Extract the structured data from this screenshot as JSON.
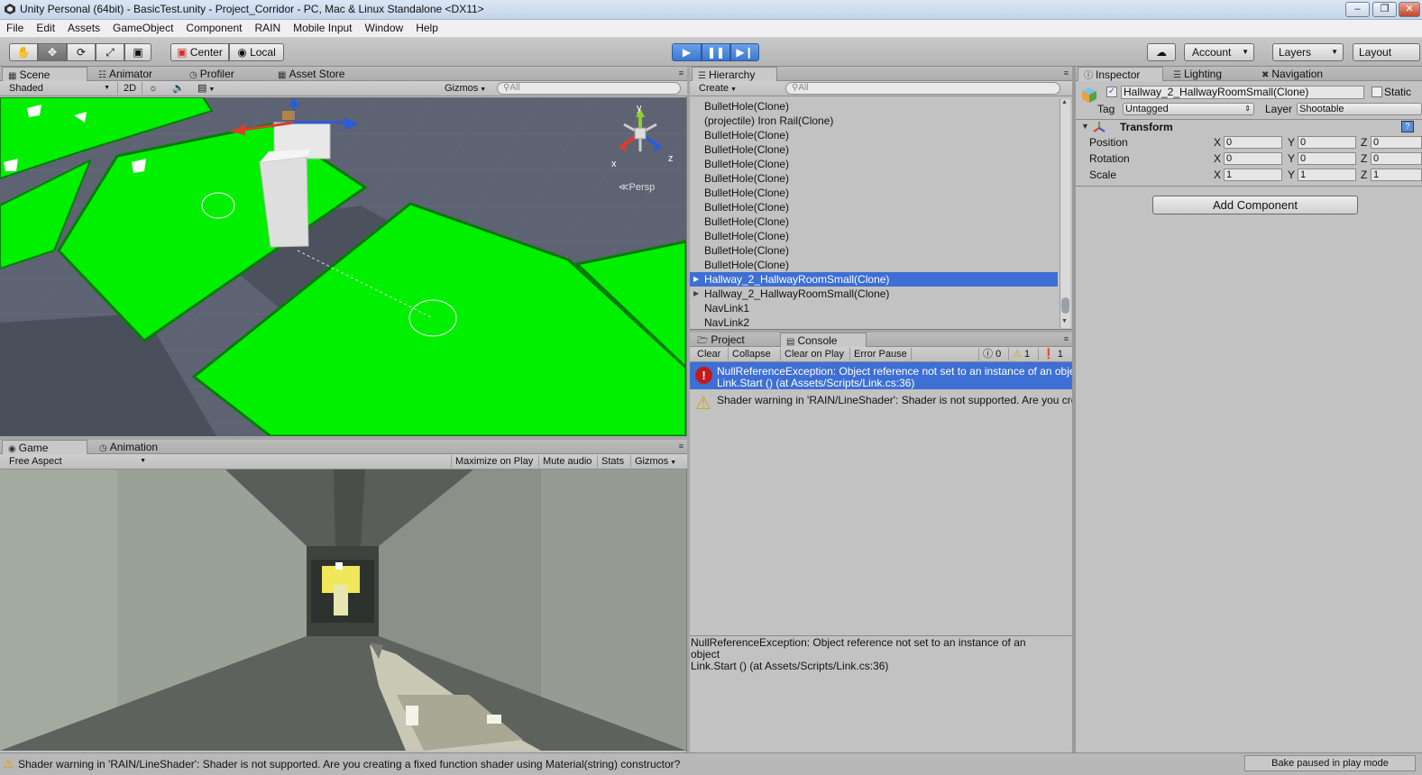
{
  "window": {
    "title": "Unity Personal (64bit) - BasicTest.unity - Project_Corridor - PC, Mac & Linux Standalone <DX11>"
  },
  "menu": [
    "File",
    "Edit",
    "Assets",
    "GameObject",
    "Component",
    "RAIN",
    "Mobile Input",
    "Window",
    "Help"
  ],
  "toolbar": {
    "pivot": "Center",
    "space": "Local",
    "account": "Account",
    "layers": "Layers",
    "layout": "Layout"
  },
  "scene_panel": {
    "tabs": [
      "Scene",
      "Animator",
      "Profiler",
      "Asset Store"
    ],
    "shading": "Shaded",
    "mode_2d": "2D",
    "gizmos": "Gizmos",
    "search_placeholder": "All",
    "persp_label": "Persp",
    "axis_y": "y",
    "axis_x": "x",
    "axis_z": "z"
  },
  "game_panel": {
    "tabs": [
      "Game",
      "Animation"
    ],
    "aspect": "Free Aspect",
    "buttons": [
      "Maximize on Play",
      "Mute audio",
      "Stats",
      "Gizmos"
    ]
  },
  "hierarchy": {
    "tab": "Hierarchy",
    "create": "Create",
    "search_placeholder": "All",
    "items": [
      "BulletHole(Clone)",
      "(projectile) Iron Rail(Clone)",
      "BulletHole(Clone)",
      "BulletHole(Clone)",
      "BulletHole(Clone)",
      "BulletHole(Clone)",
      "BulletHole(Clone)",
      "BulletHole(Clone)",
      "BulletHole(Clone)",
      "BulletHole(Clone)",
      "BulletHole(Clone)",
      "BulletHole(Clone)",
      "Hallway_2_HallwayRoomSmall(Clone)",
      "Hallway_2_HallwayRoomSmall(Clone)",
      "NavLink1",
      "NavLink2"
    ],
    "selected_index": 12
  },
  "console": {
    "tabs": [
      "Project",
      "Console"
    ],
    "buttons": [
      "Clear",
      "Collapse",
      "Clear on Play",
      "Error Pause"
    ],
    "counts": {
      "info": "0",
      "warning": "1",
      "error": "1"
    },
    "entries": [
      {
        "type": "error",
        "line1": "NullReferenceException: Object reference not set to an instance of an object",
        "line2": "Link.Start () (at Assets/Scripts/Link.cs:36)"
      },
      {
        "type": "warning",
        "line1": "Shader warning in 'RAIN/LineShader': Shader is not supported. Are you creating a fixed function shader using Material(string) constructor?",
        "line2": ""
      }
    ],
    "detail": [
      "NullReferenceException: Object reference not set to an instance of an",
      "object",
      "Link.Start () (at Assets/Scripts/Link.cs:36)"
    ]
  },
  "inspector": {
    "tabs": [
      "Inspector",
      "Lighting",
      "Navigation"
    ],
    "object_name": "Hallway_2_HallwayRoomSmall(Clone)",
    "static_label": "Static",
    "tag_label": "Tag",
    "tag_value": "Untagged",
    "layer_label": "Layer",
    "layer_value": "Shootable",
    "component": "Transform",
    "rows": [
      {
        "label": "Position",
        "x": "0",
        "y": "0",
        "z": "0"
      },
      {
        "label": "Rotation",
        "x": "0",
        "y": "0",
        "z": "0"
      },
      {
        "label": "Scale",
        "x": "1",
        "y": "1",
        "z": "1"
      }
    ],
    "add_component": "Add Component"
  },
  "status": {
    "message": "Shader warning in 'RAIN/LineShader': Shader is not supported. Are you creating a fixed function shader using Material(string) constructor?",
    "bake": "Bake paused in play mode"
  },
  "colors": {
    "selection": "#3d6fd4",
    "scene_green": "#00ff00",
    "scene_bg": "#5a6070",
    "play_blue": "#3a78d0"
  }
}
